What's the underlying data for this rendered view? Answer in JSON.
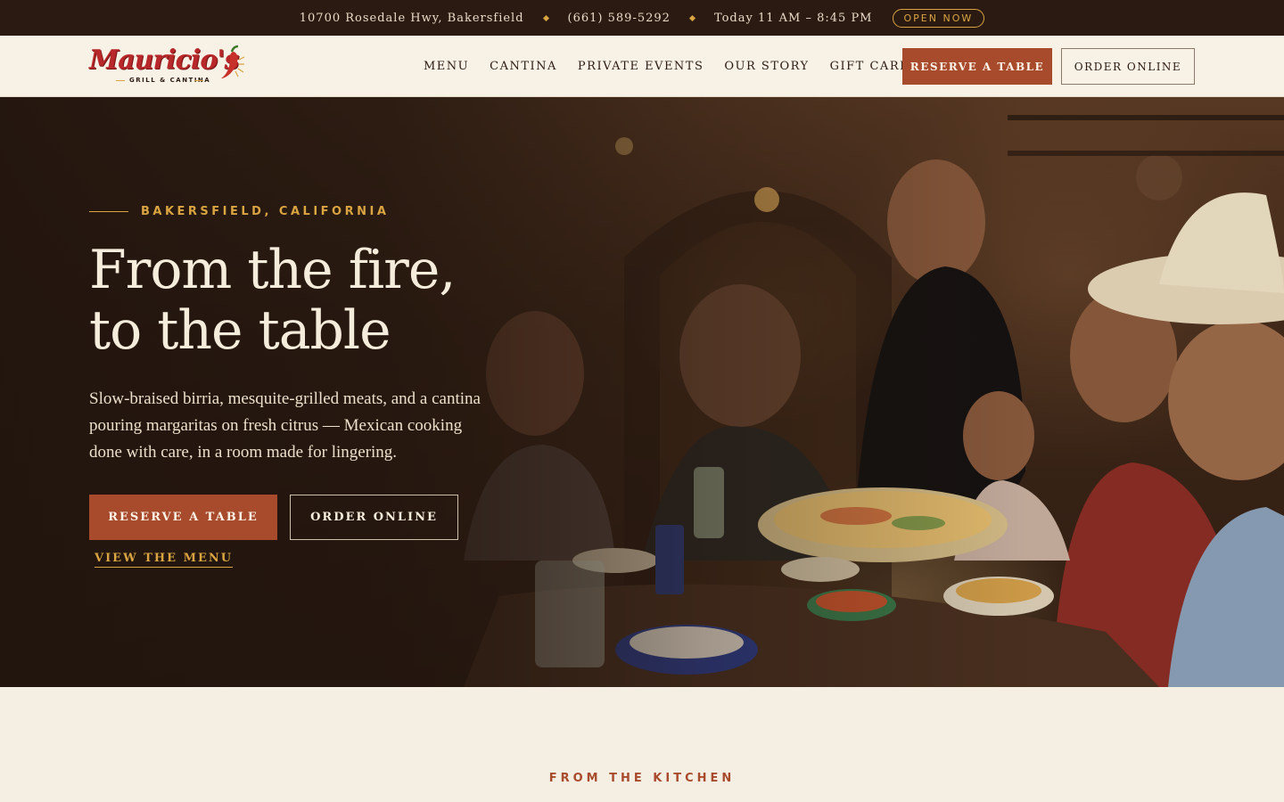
{
  "topbar": {
    "address": "10700 Rosedale Hwy, Bakersfield",
    "phone": "(661) 589-5292",
    "hours": "Today 11 AM – 8:45 PM",
    "status": "OPEN NOW"
  },
  "header": {
    "logo_text": "Mauricio's",
    "logo_tagline": "GRILL & CANTINA",
    "nav": [
      "MENU",
      "CANTINA",
      "PRIVATE EVENTS",
      "OUR STORY",
      "GIFT CARDS"
    ],
    "reserve_label": "RESERVE A TABLE",
    "order_label": "ORDER ONLINE"
  },
  "hero": {
    "eyebrow": "BAKERSFIELD, CALIFORNIA",
    "title_line1": "From the fire,",
    "title_line2": "to the table",
    "body": "Slow-braised birria, mesquite-grilled meats, and a cantina pouring margaritas on fresh citrus — Mexican cooking done with care, in a room made for lingering.",
    "reserve_label": "RESERVE A TABLE",
    "order_label": "ORDER ONLINE",
    "menu_link": "VIEW THE MENU"
  },
  "kitchen": {
    "eyebrow": "FROM THE KITCHEN"
  },
  "colors": {
    "accent": "#a84a2c",
    "gold": "#d9a441",
    "dark": "#2a1a12",
    "cream": "#f5eee3"
  }
}
